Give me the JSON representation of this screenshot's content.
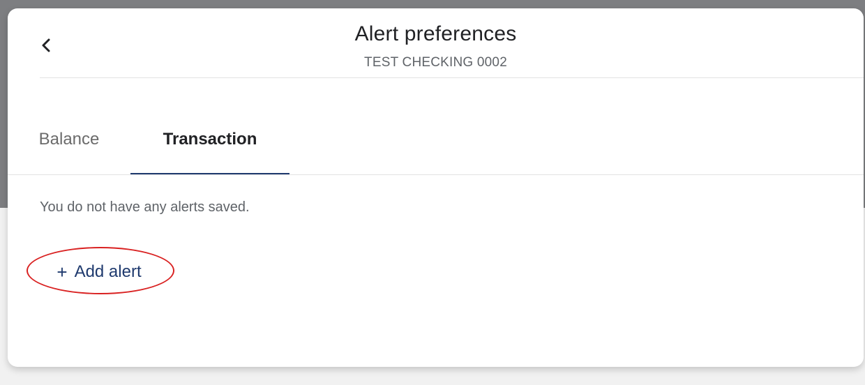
{
  "header": {
    "title": "Alert preferences",
    "subtitle": "TEST CHECKING 0002",
    "back_icon": "chevron-left-icon"
  },
  "tabs": [
    {
      "label": "Balance",
      "selected": false
    },
    {
      "label": "Transaction",
      "selected": true
    }
  ],
  "content": {
    "empty_message": "You do not have any alerts saved.",
    "add_alert": {
      "icon": "+",
      "label": "Add alert"
    }
  },
  "colors": {
    "accent": "#1f3a6e",
    "annotation": "#d92121",
    "backdrop": "#7d7e81"
  }
}
